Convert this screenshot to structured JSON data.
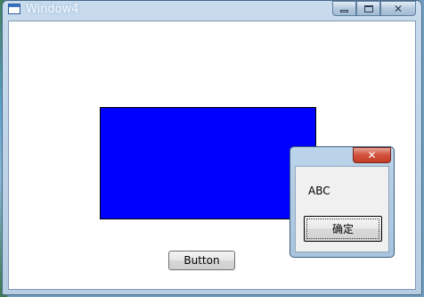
{
  "window": {
    "title": "Window4",
    "controls": {
      "minimize": "minimize",
      "maximize": "maximize",
      "close": "close"
    }
  },
  "main": {
    "button_label": "Button",
    "rect_color": "#0000ff"
  },
  "dialog": {
    "message": "ABC",
    "ok_label": "确定"
  },
  "icons": [
    "window-icon",
    "minimize-icon",
    "maximize-icon",
    "close-icon"
  ]
}
